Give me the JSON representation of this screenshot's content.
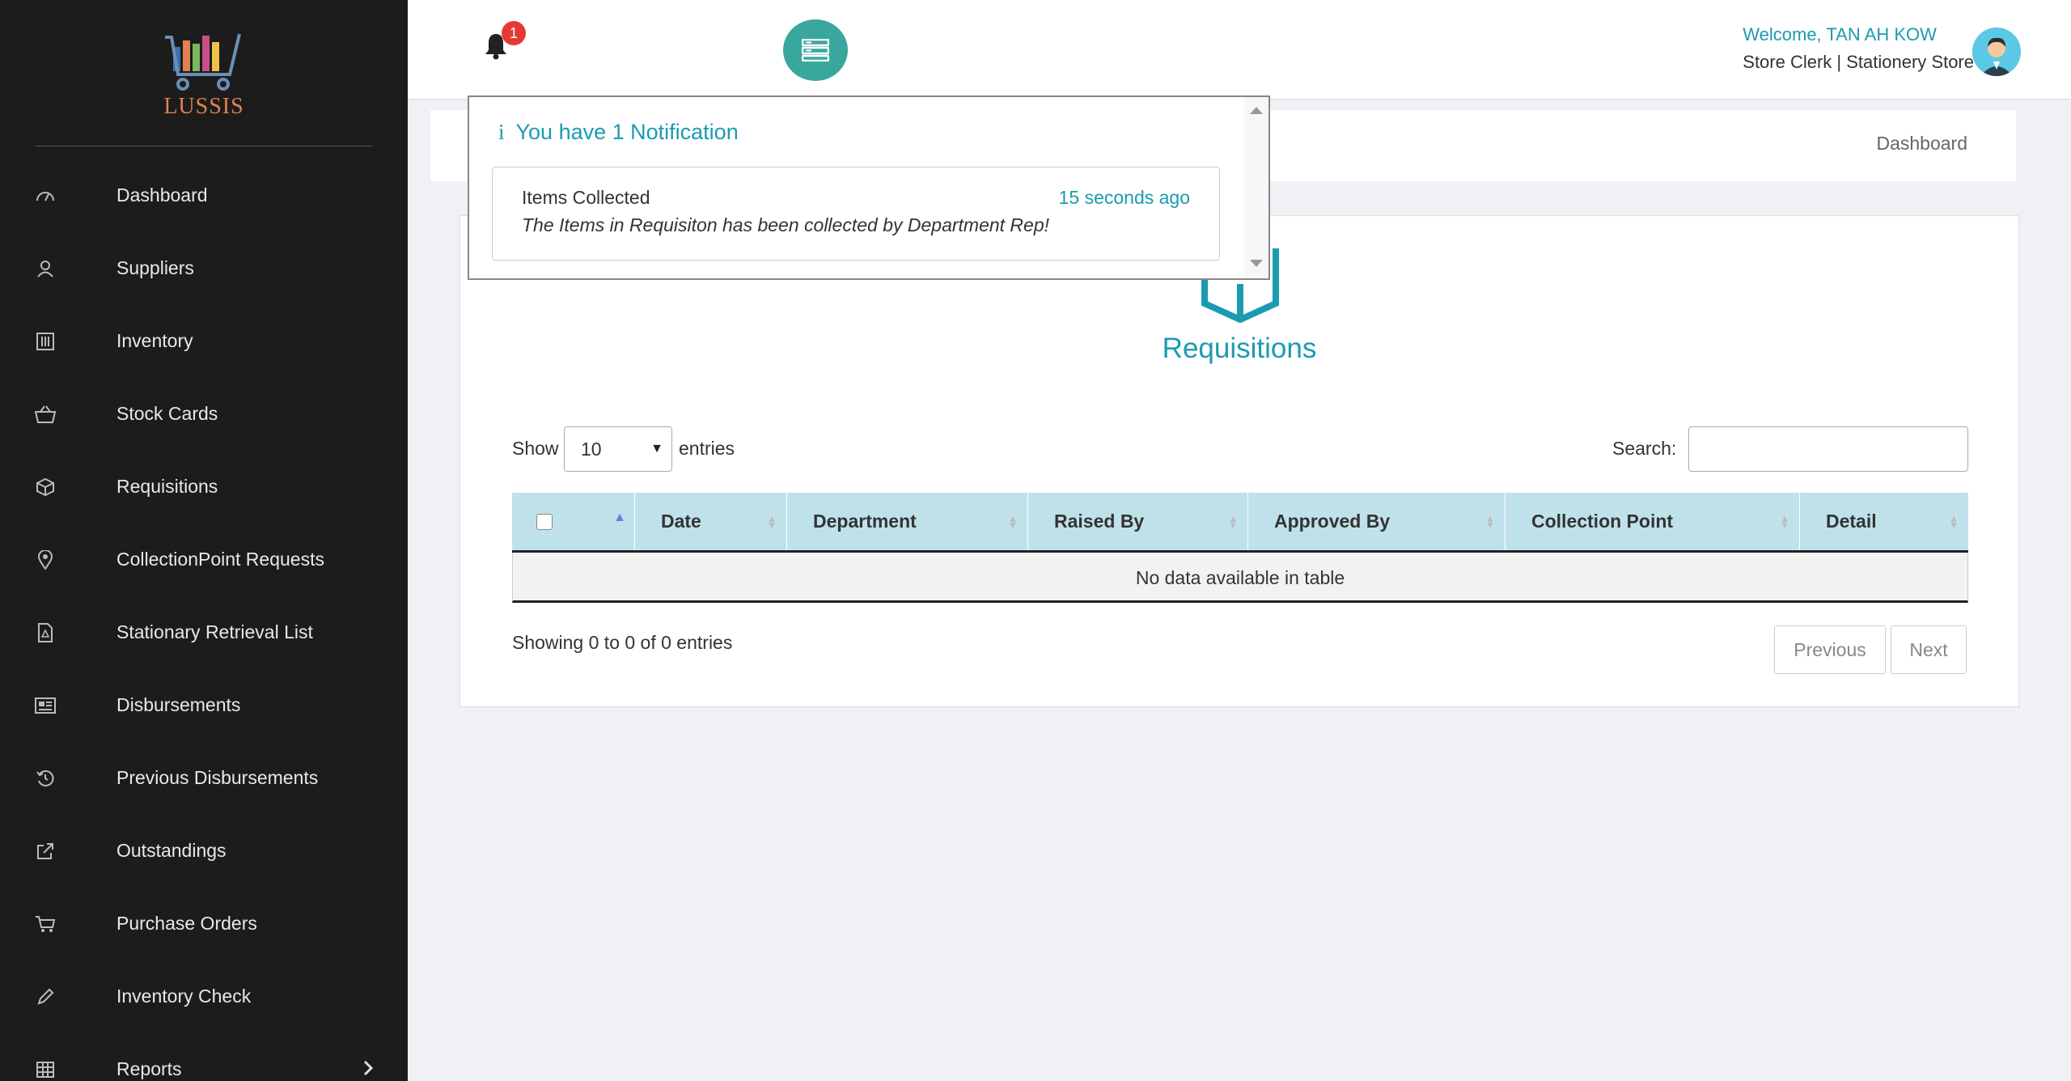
{
  "app": {
    "logo_text": "LUSSIS"
  },
  "sidebar": {
    "items": [
      {
        "label": "Dashboard",
        "icon": "dashboard-icon"
      },
      {
        "label": "Suppliers",
        "icon": "user-icon"
      },
      {
        "label": "Inventory",
        "icon": "inventory-icon"
      },
      {
        "label": "Stock Cards",
        "icon": "basket-icon"
      },
      {
        "label": "Requisitions",
        "icon": "box-icon"
      },
      {
        "label": "CollectionPoint Requests",
        "icon": "location-pin-icon"
      },
      {
        "label": "Stationary Retrieval List",
        "icon": "pdf-file-icon"
      },
      {
        "label": "Disbursements",
        "icon": "newspaper-icon"
      },
      {
        "label": "Previous Disbursements",
        "icon": "history-icon"
      },
      {
        "label": "Outstandings",
        "icon": "external-link-icon"
      },
      {
        "label": "Purchase Orders",
        "icon": "cart-icon"
      },
      {
        "label": "Inventory Check",
        "icon": "pencil-icon"
      },
      {
        "label": "Reports",
        "icon": "table-icon"
      }
    ]
  },
  "header": {
    "notification_count": "1",
    "welcome": "Welcome, TAN AH KOW",
    "role": "Store Clerk | Stationery Store"
  },
  "breadcrumb": {
    "current": "Dashboard"
  },
  "notifications": {
    "heading_icon": "i",
    "heading": "You have 1 Notification",
    "items": [
      {
        "title": "Items Collected",
        "time": "15 seconds ago",
        "message": "The Items in Requisiton has been collected by Department Rep!"
      }
    ]
  },
  "main": {
    "title": "Requisitions",
    "show_label": "Show",
    "page_size": "10",
    "entries_label": "entries",
    "search_label": "Search:",
    "columns": [
      "Date",
      "Department",
      "Raised By",
      "Approved By",
      "Collection Point",
      "Detail"
    ],
    "empty_message": "No data available in table",
    "info": "Showing 0 to 0 of 0 entries",
    "prev_label": "Previous",
    "next_label": "Next"
  },
  "colors": {
    "accent": "#1b9bb0",
    "sidebar_bg": "#1c1c1c",
    "toggle_bg": "#3aa79e",
    "header_row_bg": "#bfe2ea",
    "badge": "#e53935"
  }
}
